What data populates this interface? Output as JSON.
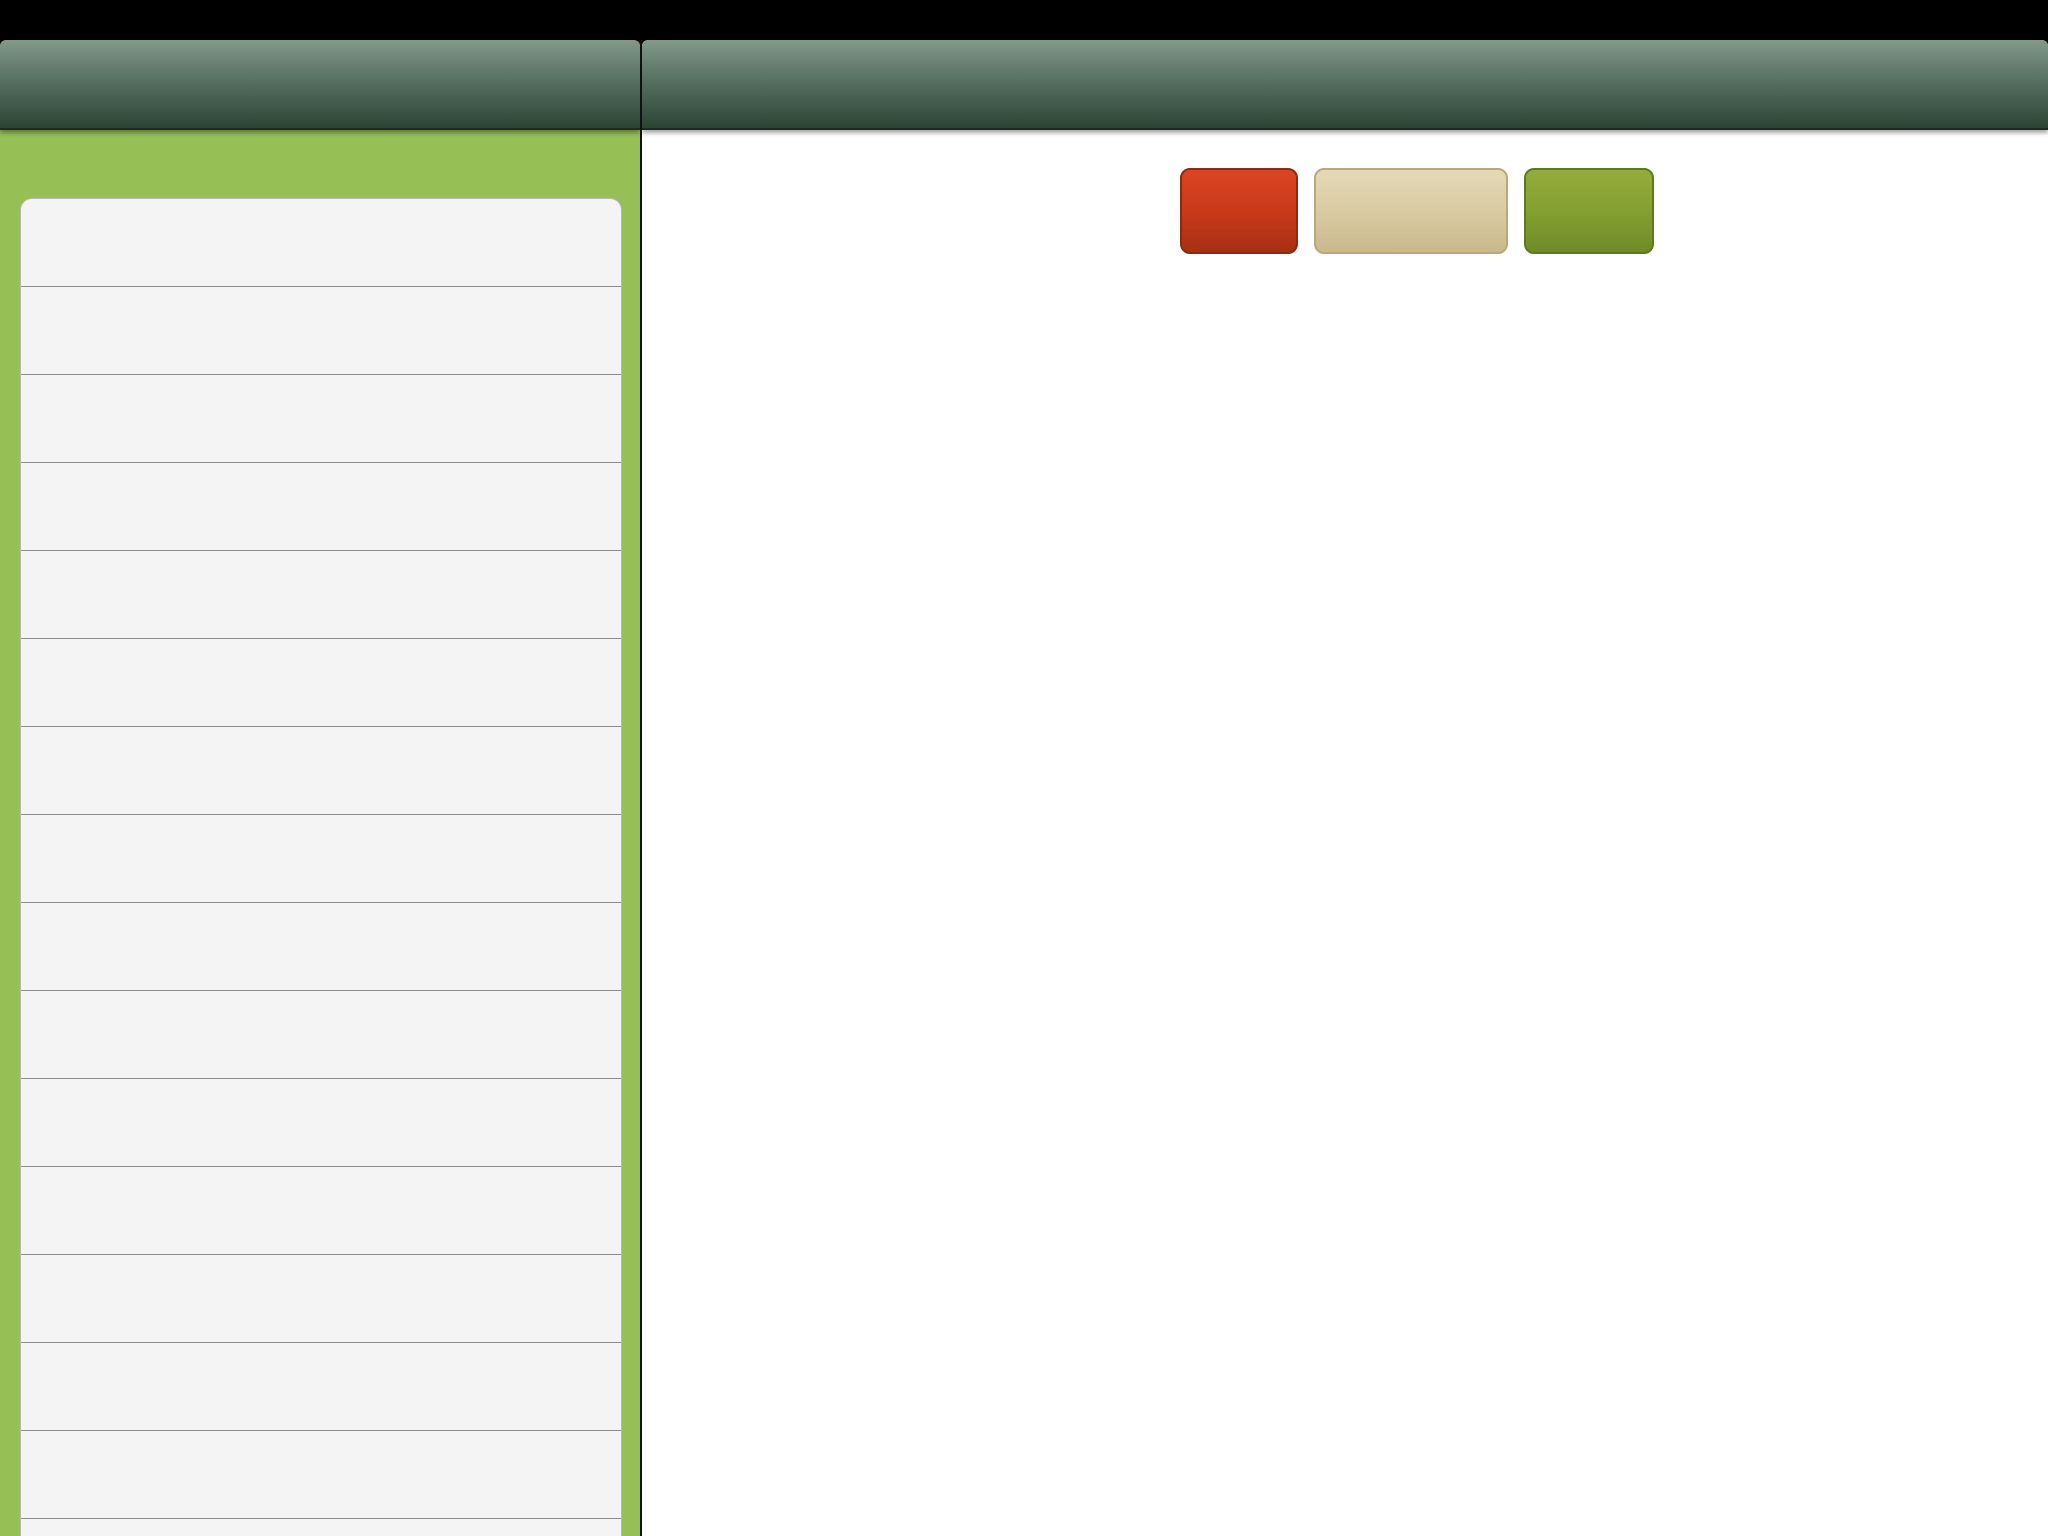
{
  "status_bar": {
    "carrier": ""
  },
  "master": {
    "title": "",
    "items": [
      {
        "label": ""
      },
      {
        "label": ""
      },
      {
        "label": ""
      },
      {
        "label": ""
      },
      {
        "label": ""
      },
      {
        "label": ""
      },
      {
        "label": ""
      },
      {
        "label": ""
      },
      {
        "label": ""
      },
      {
        "label": ""
      },
      {
        "label": ""
      },
      {
        "label": ""
      },
      {
        "label": ""
      },
      {
        "label": ""
      },
      {
        "label": ""
      },
      {
        "label": ""
      }
    ]
  },
  "detail": {
    "title": "",
    "buttons": {
      "red_label": "",
      "tan_label": "",
      "green_label": ""
    }
  },
  "colors": {
    "sidebar_green": "#96bf55",
    "navbar_dark": "#2c4434",
    "button_red": "#c93a1a",
    "button_tan": "#d9cba2",
    "button_green": "#84a032"
  }
}
